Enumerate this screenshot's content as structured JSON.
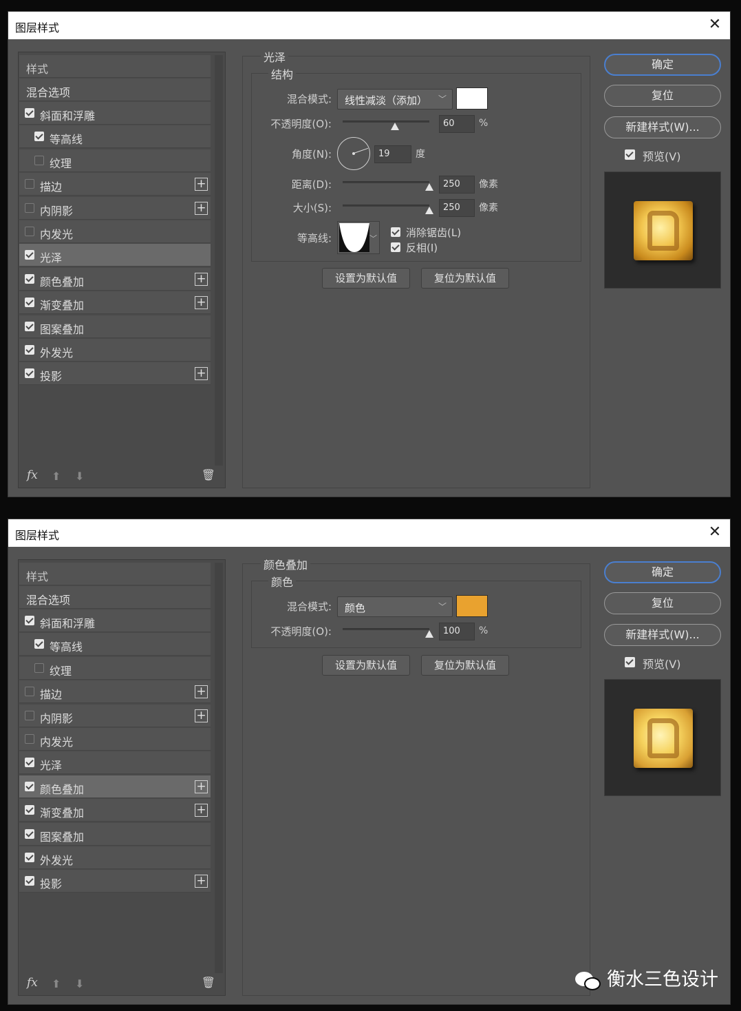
{
  "dialogs": [
    {
      "title": "图层样式",
      "close_glyph": "✕",
      "style_list": {
        "header": "样式",
        "blend_options": "混合选项",
        "items": [
          {
            "label": "斜面和浮雕",
            "checked": true,
            "indent": false,
            "plus": false,
            "selected": false
          },
          {
            "label": "等高线",
            "checked": true,
            "indent": true,
            "plus": false,
            "selected": false
          },
          {
            "label": "纹理",
            "checked": false,
            "indent": true,
            "plus": false,
            "selected": false
          },
          {
            "label": "描边",
            "checked": false,
            "indent": false,
            "plus": true,
            "selected": false
          },
          {
            "label": "内阴影",
            "checked": false,
            "indent": false,
            "plus": true,
            "selected": false
          },
          {
            "label": "内发光",
            "checked": false,
            "indent": false,
            "plus": false,
            "selected": false
          },
          {
            "label": "光泽",
            "checked": true,
            "indent": false,
            "plus": false,
            "selected": true
          },
          {
            "label": "颜色叠加",
            "checked": true,
            "indent": false,
            "plus": true,
            "selected": false
          },
          {
            "label": "渐变叠加",
            "checked": true,
            "indent": false,
            "plus": true,
            "selected": false
          },
          {
            "label": "图案叠加",
            "checked": true,
            "indent": false,
            "plus": false,
            "selected": false
          },
          {
            "label": "外发光",
            "checked": true,
            "indent": false,
            "plus": false,
            "selected": false
          },
          {
            "label": "投影",
            "checked": true,
            "indent": false,
            "plus": true,
            "selected": false
          }
        ],
        "plus_glyph": "+",
        "fx": "fx",
        "up_glyph": "⬆",
        "down_glyph": "⬇",
        "trash_glyph": "🗑"
      },
      "panel": {
        "group_title": "光泽",
        "sub_title": "结构",
        "blend_mode_label": "混合模式:",
        "blend_mode_value": "线性减淡（添加）",
        "swatch_color": "#ffffff",
        "opacity_label": "不透明度(O):",
        "opacity_value": "60",
        "opacity_fraction": 0.6,
        "opacity_unit": "%",
        "angle_label": "角度(N):",
        "angle_value": "19",
        "angle_unit": "度",
        "distance_label": "距离(D):",
        "distance_value": "250",
        "distance_fraction": 1.0,
        "distance_unit": "像素",
        "size_label": "大小(S):",
        "size_value": "250",
        "size_fraction": 1.0,
        "size_unit": "像素",
        "contour_label": "等高线:",
        "antialias_label": "消除锯齿(L)",
        "antialias_checked": true,
        "invert_label": "反相(I)",
        "invert_checked": true,
        "set_default": "设置为默认值",
        "reset_default": "复位为默认值",
        "dropdown_glyph": "﹀"
      },
      "right": {
        "ok": "确定",
        "reset": "复位",
        "new_style": "新建样式(W)...",
        "preview_label": "预览(V)",
        "preview_checked": true
      }
    },
    {
      "title": "图层样式",
      "close_glyph": "✕",
      "style_list": {
        "header": "样式",
        "blend_options": "混合选项",
        "items": [
          {
            "label": "斜面和浮雕",
            "checked": true,
            "indent": false,
            "plus": false,
            "selected": false
          },
          {
            "label": "等高线",
            "checked": true,
            "indent": true,
            "plus": false,
            "selected": false
          },
          {
            "label": "纹理",
            "checked": false,
            "indent": true,
            "plus": false,
            "selected": false
          },
          {
            "label": "描边",
            "checked": false,
            "indent": false,
            "plus": true,
            "selected": false
          },
          {
            "label": "内阴影",
            "checked": false,
            "indent": false,
            "plus": true,
            "selected": false
          },
          {
            "label": "内发光",
            "checked": false,
            "indent": false,
            "plus": false,
            "selected": false
          },
          {
            "label": "光泽",
            "checked": true,
            "indent": false,
            "plus": false,
            "selected": false
          },
          {
            "label": "颜色叠加",
            "checked": true,
            "indent": false,
            "plus": true,
            "selected": true
          },
          {
            "label": "渐变叠加",
            "checked": true,
            "indent": false,
            "plus": true,
            "selected": false
          },
          {
            "label": "图案叠加",
            "checked": true,
            "indent": false,
            "plus": false,
            "selected": false
          },
          {
            "label": "外发光",
            "checked": true,
            "indent": false,
            "plus": false,
            "selected": false
          },
          {
            "label": "投影",
            "checked": true,
            "indent": false,
            "plus": true,
            "selected": false
          }
        ],
        "plus_glyph": "+",
        "fx": "fx",
        "up_glyph": "⬆",
        "down_glyph": "⬇",
        "trash_glyph": "🗑"
      },
      "panel": {
        "group_title": "颜色叠加",
        "sub_title": "颜色",
        "blend_mode_label": "混合模式:",
        "blend_mode_value": "颜色",
        "swatch_color": "#e9a22f",
        "opacity_label": "不透明度(O):",
        "opacity_value": "100",
        "opacity_fraction": 1.0,
        "opacity_unit": "%",
        "set_default": "设置为默认值",
        "reset_default": "复位为默认值",
        "dropdown_glyph": "﹀"
      },
      "right": {
        "ok": "确定",
        "reset": "复位",
        "new_style": "新建样式(W)...",
        "preview_label": "预览(V)",
        "preview_checked": true
      }
    }
  ],
  "watermark": "衡水三色设计"
}
